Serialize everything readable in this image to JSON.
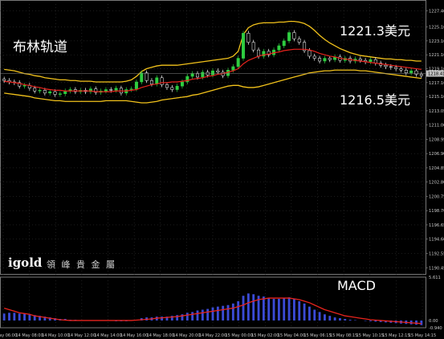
{
  "annotations": {
    "title": "布林轨道",
    "upper": "1221.3美元",
    "lower": "1216.5美元",
    "macd": "MACD"
  },
  "brand": {
    "logo": "igold",
    "cn": "領 峰 貴 金 屬"
  },
  "colors": {
    "background": "#000000",
    "grid": "#3a3a3a",
    "axis_text": "#c8c8c8",
    "bull_candle": "#2ecc40",
    "bear_candle": "#ffffff",
    "bollinger": "#f2c21b",
    "moving_average": "#e8231d",
    "macd_histogram": "#3b4bd6",
    "macd_signal": "#e8231d",
    "current_price_tag": "#c0c0c0"
  },
  "chart_data": {
    "type": "candlestick",
    "price_axis": {
      "ticks": [
        "1227.40",
        "1225.10",
        "1223.10",
        "1221.10",
        "1219.10",
        "1217.10",
        "1215.10",
        "1213.05",
        "1211.00",
        "1208.95",
        "1206.90",
        "1204.85",
        "1202.80",
        "1200.75",
        "1198.70",
        "1196.65",
        "1194.60",
        "1192.55",
        "1190.45"
      ],
      "ylim": [
        1189.6,
        1228.4
      ],
      "current_price": "1218.41"
    },
    "macd_axis": {
      "ticks": [
        "5.611",
        "0.00",
        "-0.940"
      ],
      "ylim": [
        -0.94,
        5.611
      ]
    },
    "time_labels": [
      "14 May 06:00",
      "14 May 08:00",
      "14 May 10:00",
      "14 May 12:00",
      "14 May 14:00",
      "14 May 16:00",
      "14 May 18:00",
      "14 May 20:00",
      "14 May 22:00",
      "15 May 00:00",
      "15 May 02:00",
      "15 May 04:00",
      "15 May 06:15",
      "15 May 08:15",
      "15 May 10:15",
      "15 May 12:15",
      "15 May 14:15"
    ],
    "close": [
      1217.4,
      1217.2,
      1217.1,
      1216.6,
      1216.7,
      1216.3,
      1215.9,
      1216.0,
      1215.6,
      1215.8,
      1215.4,
      1215.5,
      1215.9,
      1216.1,
      1215.8,
      1216.0,
      1215.8,
      1216.2,
      1215.7,
      1215.9,
      1216.1,
      1216.0,
      1216.3,
      1215.6,
      1216.1,
      1216.2,
      1217.2,
      1218.5,
      1217.4,
      1216.9,
      1217.8,
      1216.8,
      1216.4,
      1216.1,
      1216.6,
      1217.2,
      1218.0,
      1218.4,
      1217.9,
      1218.6,
      1218.2,
      1218.8,
      1218.6,
      1218.1,
      1218.9,
      1219.4,
      1220.6,
      1224.2,
      1222.9,
      1221.8,
      1220.9,
      1221.6,
      1221.1,
      1221.8,
      1222.4,
      1223.1,
      1224.3,
      1223.4,
      1222.9,
      1221.7,
      1220.9,
      1220.6,
      1220.2,
      1220.6,
      1220.4,
      1220.8,
      1220.3,
      1220.6,
      1220.2,
      1220.5,
      1220.3,
      1220.1,
      1220.4,
      1219.9,
      1219.6,
      1219.4,
      1219.3,
      1219.1,
      1218.9,
      1218.5,
      1218.8,
      1218.3,
      1218.1
    ],
    "open": [
      1217.6,
      1217.4,
      1217.2,
      1217.1,
      1216.6,
      1216.7,
      1216.3,
      1215.9,
      1216.0,
      1215.6,
      1215.8,
      1215.4,
      1215.5,
      1215.9,
      1216.1,
      1215.8,
      1216.0,
      1215.8,
      1216.2,
      1215.7,
      1215.9,
      1216.1,
      1216.0,
      1216.3,
      1215.6,
      1216.1,
      1216.2,
      1217.2,
      1218.5,
      1217.4,
      1216.9,
      1217.8,
      1216.8,
      1216.4,
      1216.1,
      1216.6,
      1217.2,
      1218.0,
      1218.4,
      1217.9,
      1218.6,
      1218.2,
      1218.8,
      1218.6,
      1218.1,
      1218.9,
      1219.4,
      1220.6,
      1224.2,
      1222.9,
      1221.8,
      1220.9,
      1221.6,
      1221.1,
      1221.8,
      1222.4,
      1223.1,
      1224.3,
      1223.4,
      1222.9,
      1221.7,
      1220.9,
      1220.6,
      1220.2,
      1220.6,
      1220.4,
      1220.8,
      1220.3,
      1220.6,
      1220.2,
      1220.5,
      1220.3,
      1220.1,
      1220.4,
      1219.9,
      1219.6,
      1219.4,
      1219.3,
      1219.1,
      1218.9,
      1218.5,
      1218.8,
      1218.3
    ],
    "bollinger_upper": [
      1219.0,
      1218.9,
      1218.8,
      1218.6,
      1218.4,
      1218.3,
      1218.1,
      1218.0,
      1217.8,
      1217.7,
      1217.6,
      1217.5,
      1217.5,
      1217.4,
      1217.4,
      1217.3,
      1217.3,
      1217.3,
      1217.2,
      1217.2,
      1217.2,
      1217.2,
      1217.2,
      1217.2,
      1217.3,
      1217.5,
      1218.0,
      1218.7,
      1219.1,
      1219.3,
      1219.5,
      1219.6,
      1219.6,
      1219.6,
      1219.6,
      1219.7,
      1219.8,
      1219.9,
      1220.0,
      1220.1,
      1220.2,
      1220.3,
      1220.4,
      1220.5,
      1220.6,
      1220.9,
      1221.6,
      1224.0,
      1225.0,
      1225.4,
      1225.6,
      1225.7,
      1225.7,
      1225.7,
      1225.8,
      1225.8,
      1225.9,
      1225.9,
      1225.8,
      1225.6,
      1225.2,
      1224.6,
      1223.9,
      1223.3,
      1222.8,
      1222.4,
      1222.0,
      1221.7,
      1221.4,
      1221.2,
      1221.0,
      1220.9,
      1220.8,
      1220.7,
      1220.6,
      1220.5,
      1220.5,
      1220.4,
      1220.4,
      1220.3,
      1220.3,
      1220.2,
      1220.2
    ],
    "bollinger_lower": [
      1215.6,
      1215.5,
      1215.4,
      1215.3,
      1215.2,
      1215.1,
      1214.9,
      1214.8,
      1214.7,
      1214.6,
      1214.5,
      1214.5,
      1214.4,
      1214.4,
      1214.4,
      1214.4,
      1214.4,
      1214.4,
      1214.4,
      1214.4,
      1214.5,
      1214.5,
      1214.5,
      1214.5,
      1214.5,
      1214.4,
      1214.3,
      1214.2,
      1214.2,
      1214.3,
      1214.4,
      1214.6,
      1214.7,
      1214.8,
      1214.9,
      1215.0,
      1215.1,
      1215.3,
      1215.4,
      1215.6,
      1215.8,
      1216.0,
      1216.2,
      1216.4,
      1216.6,
      1216.7,
      1216.7,
      1216.5,
      1216.4,
      1216.4,
      1216.5,
      1216.7,
      1216.9,
      1217.1,
      1217.3,
      1217.5,
      1217.7,
      1217.9,
      1218.1,
      1218.3,
      1218.5,
      1218.6,
      1218.7,
      1218.8,
      1218.8,
      1218.9,
      1218.9,
      1218.9,
      1218.9,
      1218.9,
      1218.8,
      1218.8,
      1218.7,
      1218.6,
      1218.5,
      1218.4,
      1218.3,
      1218.2,
      1218.1,
      1218.0,
      1217.9,
      1217.8,
      1217.7
    ],
    "moving_average": [
      1217.3,
      1217.2,
      1217.1,
      1217.0,
      1216.8,
      1216.7,
      1216.5,
      1216.4,
      1216.2,
      1216.1,
      1216.0,
      1216.0,
      1215.9,
      1215.9,
      1215.9,
      1215.9,
      1215.9,
      1215.9,
      1215.8,
      1215.8,
      1215.8,
      1215.8,
      1215.9,
      1215.9,
      1215.9,
      1216.0,
      1216.1,
      1216.4,
      1216.6,
      1216.8,
      1216.9,
      1217.1,
      1217.1,
      1217.2,
      1217.2,
      1217.3,
      1217.4,
      1217.6,
      1217.7,
      1217.8,
      1218.0,
      1218.1,
      1218.3,
      1218.4,
      1218.6,
      1218.8,
      1219.1,
      1219.8,
      1220.3,
      1220.6,
      1220.9,
      1221.1,
      1221.2,
      1221.4,
      1221.5,
      1221.7,
      1221.8,
      1221.9,
      1221.9,
      1221.9,
      1221.8,
      1221.6,
      1221.3,
      1221.1,
      1220.9,
      1220.8,
      1220.6,
      1220.5,
      1220.4,
      1220.3,
      1220.2,
      1220.1,
      1220.0,
      1219.9,
      1219.8,
      1219.7,
      1219.6,
      1219.5,
      1219.4,
      1219.3,
      1219.2,
      1219.1,
      1219.0
    ],
    "macd_histogram": [
      0.9,
      1.0,
      1.0,
      0.9,
      0.9,
      0.8,
      0.7,
      0.6,
      0.5,
      0.4,
      0.3,
      0.2,
      0.2,
      0.1,
      0.1,
      0.05,
      0.05,
      0.05,
      0.0,
      0.0,
      -0.05,
      -0.05,
      -0.1,
      -0.1,
      -0.1,
      -0.05,
      0.1,
      0.3,
      0.4,
      0.4,
      0.5,
      0.5,
      0.5,
      0.6,
      0.7,
      0.8,
      1.0,
      1.1,
      1.3,
      1.4,
      1.5,
      1.7,
      1.8,
      1.9,
      2.0,
      2.2,
      2.5,
      3.2,
      3.5,
      3.4,
      3.2,
      3.1,
      2.9,
      2.8,
      2.8,
      2.9,
      3.0,
      2.8,
      2.5,
      2.2,
      1.8,
      1.4,
      1.1,
      0.8,
      0.6,
      0.4,
      0.3,
      0.2,
      0.1,
      0.05,
      0.0,
      -0.05,
      -0.1,
      -0.15,
      -0.2,
      -0.25,
      -0.3,
      -0.35,
      -0.4,
      -0.45,
      -0.5,
      -0.55,
      -0.6
    ],
    "macd_signal": [
      1.6,
      1.4,
      1.2,
      1.0,
      0.9,
      0.8,
      0.6,
      0.5,
      0.4,
      0.3,
      0.2,
      0.1,
      0.05,
      0.0,
      0.0,
      0.0,
      0.0,
      0.0,
      0.0,
      0.0,
      0.0,
      0.0,
      0.0,
      0.0,
      0.0,
      0.0,
      0.05,
      0.1,
      0.15,
      0.2,
      0.3,
      0.35,
      0.4,
      0.45,
      0.5,
      0.6,
      0.7,
      0.8,
      0.9,
      1.0,
      1.1,
      1.2,
      1.3,
      1.4,
      1.5,
      1.6,
      1.8,
      2.0,
      2.3,
      2.5,
      2.7,
      2.8,
      2.9,
      2.9,
      2.9,
      2.9,
      2.9,
      2.8,
      2.7,
      2.5,
      2.3,
      2.0,
      1.7,
      1.4,
      1.2,
      1.0,
      0.8,
      0.6,
      0.5,
      0.4,
      0.3,
      0.2,
      0.1,
      0.05,
      0.0,
      -0.05,
      -0.1,
      -0.15,
      -0.2,
      -0.25,
      -0.3,
      -0.35,
      -0.4
    ]
  }
}
